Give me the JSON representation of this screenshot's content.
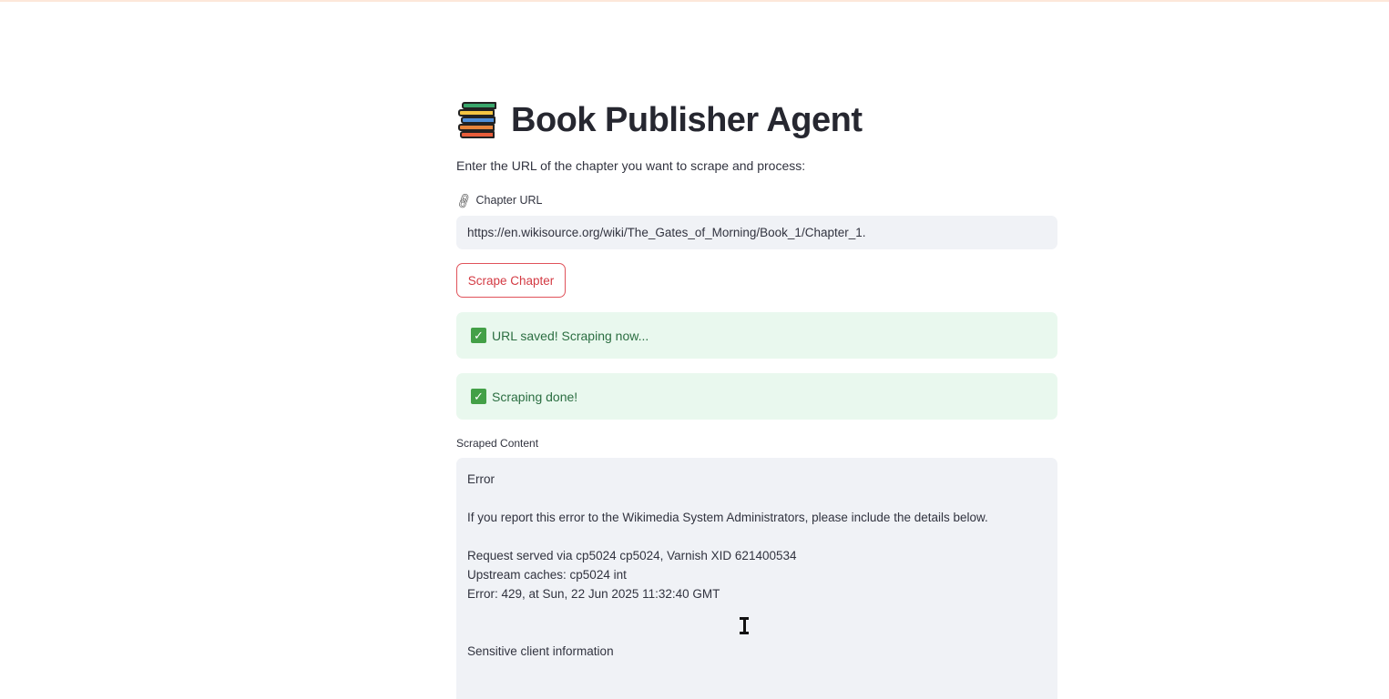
{
  "header": {
    "title": "Book Publisher Agent",
    "icon": "books-icon"
  },
  "intro": {
    "text": "Enter the URL of the chapter you want to scrape and process:"
  },
  "url_field": {
    "label": "Chapter URL",
    "icon": "link-icon",
    "value": "https://en.wikisource.org/wiki/The_Gates_of_Morning/Book_1/Chapter_1."
  },
  "actions": {
    "scrape_label": "Scrape Chapter"
  },
  "alerts": [
    {
      "icon": "check-icon",
      "text": "URL saved! Scraping now..."
    },
    {
      "icon": "check-icon",
      "text": "Scraping done!"
    }
  ],
  "scraped": {
    "label": "Scraped Content",
    "lines": [
      "Error",
      "",
      "If you report this error to the Wikimedia System Administrators, please include the details below.",
      "",
      "Request served via cp5024 cp5024, Varnish XID 621400534",
      "Upstream caches: cp5024 int",
      "Error: 429, at Sun, 22 Jun 2025 11:32:40 GMT",
      "",
      "",
      "Sensitive client information"
    ]
  },
  "colors": {
    "accent": "#d33a43",
    "success_bg": "#e9f8ee",
    "success_text": "#2b6e41",
    "input_bg": "#f0f2f6"
  }
}
